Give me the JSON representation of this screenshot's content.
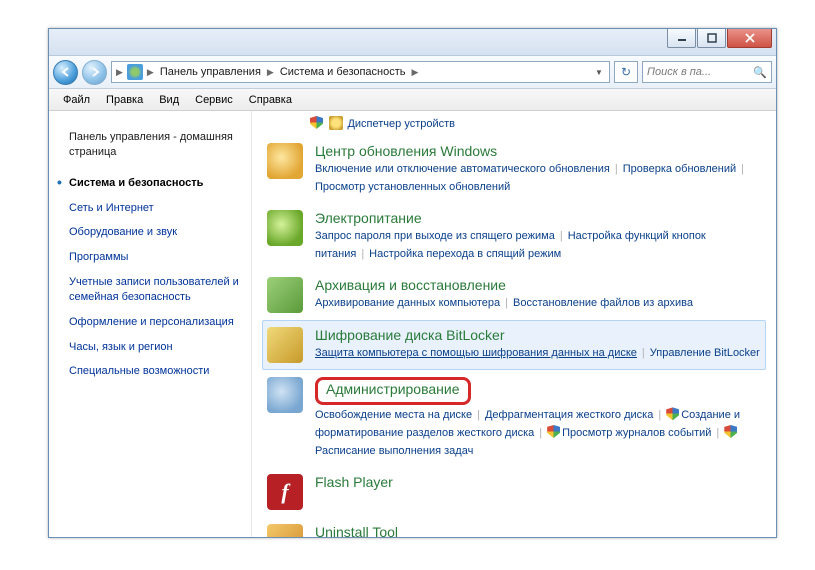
{
  "breadcrumbs": {
    "root": "Панель управления",
    "current": "Система и безопасность"
  },
  "search_placeholder": "Поиск в па...",
  "menubar": [
    "Файл",
    "Правка",
    "Вид",
    "Сервис",
    "Справка"
  ],
  "sidebar": {
    "home": "Панель управления - домашняя страница",
    "items": [
      "Система и безопасность",
      "Сеть и Интернет",
      "Оборудование и звук",
      "Программы",
      "Учетные записи пользователей и семейная безопасность",
      "Оформление и персонализация",
      "Часы, язык и регион",
      "Специальные возможности"
    ]
  },
  "orphan_link": "Диспетчер устройств",
  "categories": [
    {
      "title": "Центр обновления Windows",
      "links": [
        {
          "t": "Включение или отключение автоматического обновления",
          "s": false
        },
        {
          "t": "Проверка обновлений",
          "s": false
        },
        {
          "t": "Просмотр установленных обновлений",
          "s": false
        }
      ]
    },
    {
      "title": "Электропитание",
      "links": [
        {
          "t": "Запрос пароля при выходе из спящего режима",
          "s": false
        },
        {
          "t": "Настройка функций кнопок питания",
          "s": false
        },
        {
          "t": "Настройка перехода в спящий режим",
          "s": false
        }
      ]
    },
    {
      "title": "Архивация и восстановление",
      "links": [
        {
          "t": "Архивирование данных компьютера",
          "s": false
        },
        {
          "t": "Восстановление файлов из архива",
          "s": false
        }
      ]
    },
    {
      "title": "Шифрование диска BitLocker",
      "links": [
        {
          "t": "Защита компьютера с помощью шифрования данных на диске",
          "s": false,
          "u": true
        },
        {
          "t": "Управление BitLocker",
          "s": false
        }
      ]
    },
    {
      "title": "Администрирование",
      "links": [
        {
          "t": "Освобождение места на диске",
          "s": false
        },
        {
          "t": "Дефрагментация жесткого диска",
          "s": false
        },
        {
          "t": "Создание и форматирование разделов жесткого диска",
          "s": true
        },
        {
          "t": "Просмотр журналов событий",
          "s": true
        },
        {
          "t": "Расписание выполнения задач",
          "s": true
        }
      ]
    },
    {
      "title": "Flash Player",
      "links": []
    },
    {
      "title": "Uninstall Tool",
      "links": []
    }
  ],
  "flash_glyph": "f"
}
